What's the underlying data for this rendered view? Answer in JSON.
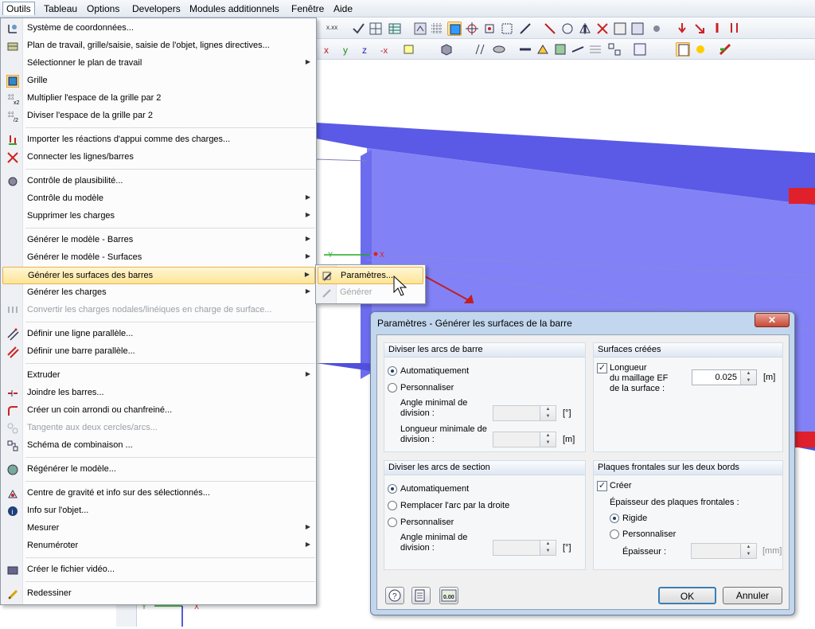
{
  "menubar": {
    "items": [
      "Outils",
      "Tableau",
      "Options",
      "Developers",
      "Modules additionnels",
      "Fenêtre",
      "Aide"
    ]
  },
  "menu": {
    "items": [
      {
        "label": "Système de coordonnées...",
        "icon": "coordinate-system-icon"
      },
      {
        "label": "Plan de travail, grille/saisie, saisie de l'objet, lignes directives...",
        "icon": "work-plane-icon"
      },
      {
        "label": "Sélectionner le plan de travail",
        "submenu": true
      },
      {
        "label": "Grille",
        "icon": "grid-icon",
        "checked": true
      },
      {
        "label": "Multiplier l'espace de la grille par 2",
        "icon": "grid-multiply-icon"
      },
      {
        "label": "Diviser l'espace de la grille par 2",
        "icon": "grid-divide-icon"
      },
      {
        "label": "Importer les réactions d'appui comme des charges...",
        "icon": "import-reactions-icon"
      },
      {
        "label": "Connecter les lignes/barres",
        "icon": "connect-lines-icon"
      },
      {
        "label": "Contrôle de plausibilité...",
        "icon": "plausibility-icon"
      },
      {
        "label": "Contrôle du modèle",
        "submenu": true
      },
      {
        "label": "Supprimer les charges",
        "submenu": true
      },
      {
        "label": "Générer le modèle - Barres",
        "submenu": true
      },
      {
        "label": "Générer le modèle - Surfaces",
        "submenu": true
      },
      {
        "label": "Générer les surfaces des barres",
        "submenu": true,
        "highlighted": true
      },
      {
        "label": "Générer les charges",
        "submenu": true
      },
      {
        "label": "Convertir les charges nodales/linéiques en charge de surface...",
        "disabled": true,
        "icon": "convert-loads-icon"
      },
      {
        "label": "Définir une ligne parallèle...",
        "icon": "parallel-line-icon"
      },
      {
        "label": "Définir une barre parallèle...",
        "icon": "parallel-member-icon"
      },
      {
        "label": "Extruder",
        "submenu": true
      },
      {
        "label": "Joindre les barres...",
        "icon": "join-members-icon"
      },
      {
        "label": "Créer un coin arrondi ou chanfreiné...",
        "icon": "fillet-icon"
      },
      {
        "label": "Tangente aux deux cercles/arcs...",
        "disabled": true,
        "icon": "tangent-icon"
      },
      {
        "label": "Schéma de combinaison ...",
        "icon": "combination-scheme-icon"
      },
      {
        "label": "Régénérer le modèle...",
        "icon": "regenerate-icon"
      },
      {
        "label": "Centre de gravité et info sur des sélectionnés...",
        "icon": "center-gravity-icon"
      },
      {
        "label": "Info sur l'objet...",
        "icon": "info-icon"
      },
      {
        "label": "Mesurer",
        "submenu": true
      },
      {
        "label": "Renuméroter",
        "submenu": true
      },
      {
        "label": "Créer le fichier vidéo...",
        "icon": "video-icon"
      },
      {
        "label": "Redessiner",
        "icon": "redraw-icon"
      }
    ]
  },
  "submenu": {
    "items": [
      {
        "label": "Paramètres..."
      },
      {
        "label": "Générer",
        "disabled": true
      }
    ]
  },
  "dialog": {
    "title": "Paramètres - Générer les surfaces de la barre",
    "close": "✕",
    "g1": {
      "title": "Diviser les arcs de barre",
      "auto": "Automatiquement",
      "custom": "Personnaliser",
      "angle_l1": "Angle minimal de",
      "angle_l2": "division :",
      "angle_unit": "[°]",
      "len_l1": "Longueur minimale de",
      "len_l2": "division :",
      "len_unit": "[m]"
    },
    "g2": {
      "title": "Surfaces créées",
      "cb_l1": "Longueur",
      "cb_l2": "du maillage EF",
      "cb_l3": "de la surface :",
      "value": "0.025",
      "unit": "[m]"
    },
    "g3": {
      "title": "Diviser les arcs de section",
      "auto": "Automatiquement",
      "replace": "Remplacer l'arc par la droite",
      "custom": "Personnaliser",
      "angle_l1": "Angle minimal de",
      "angle_l2": "division :",
      "angle_unit": "[°]"
    },
    "g4": {
      "title": "Plaques frontales sur les deux bords",
      "create": "Créer",
      "thick_title": "Épaisseur des plaques frontales :",
      "rigid": "Rigide",
      "custom": "Personnaliser",
      "thick": "Épaisseur :",
      "thick_unit": "[mm]"
    },
    "ok": "OK",
    "cancel": "Annuler",
    "units_icon_text": "0.00"
  },
  "viewport": {
    "axis_y": "Y",
    "axis_x": "X"
  },
  "colors": {
    "beam": "#6e6ef0",
    "flange_top": "#4a4ad8",
    "end_plate": "#e0202a"
  }
}
